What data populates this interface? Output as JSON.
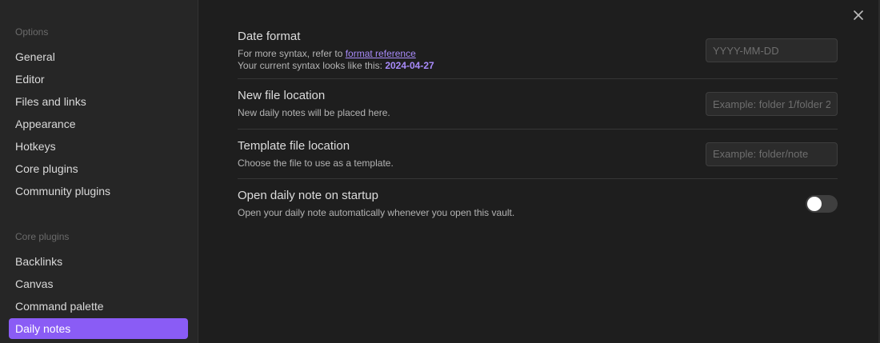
{
  "sidebar": {
    "options_header": "Options",
    "options_items": [
      {
        "label": "General"
      },
      {
        "label": "Editor"
      },
      {
        "label": "Files and links"
      },
      {
        "label": "Appearance"
      },
      {
        "label": "Hotkeys"
      },
      {
        "label": "Core plugins"
      },
      {
        "label": "Community plugins"
      }
    ],
    "core_header": "Core plugins",
    "core_items": [
      {
        "label": "Backlinks"
      },
      {
        "label": "Canvas"
      },
      {
        "label": "Command palette"
      },
      {
        "label": "Daily notes",
        "active": true
      }
    ]
  },
  "close_icon": "close-icon",
  "settings": {
    "date_format": {
      "name": "Date format",
      "desc_prefix": "For more syntax, refer to ",
      "desc_link": "format reference",
      "desc_line2_prefix": "Your current syntax looks like this: ",
      "desc_sample": "2024-04-27",
      "value": "",
      "placeholder": "YYYY-MM-DD"
    },
    "new_file_location": {
      "name": "New file location",
      "desc": "New daily notes will be placed here.",
      "value": "",
      "placeholder": "Example: folder 1/folder 2"
    },
    "template_file_location": {
      "name": "Template file location",
      "desc": "Choose the file to use as a template.",
      "value": "",
      "placeholder": "Example: folder/note"
    },
    "open_on_startup": {
      "name": "Open daily note on startup",
      "desc": "Open your daily note automatically whenever you open this vault.",
      "enabled": false
    }
  },
  "colors": {
    "accent": "#8a5cf5",
    "link": "#a88bfa",
    "background": "#1e1e1e",
    "sidebar_bg": "#262626"
  }
}
